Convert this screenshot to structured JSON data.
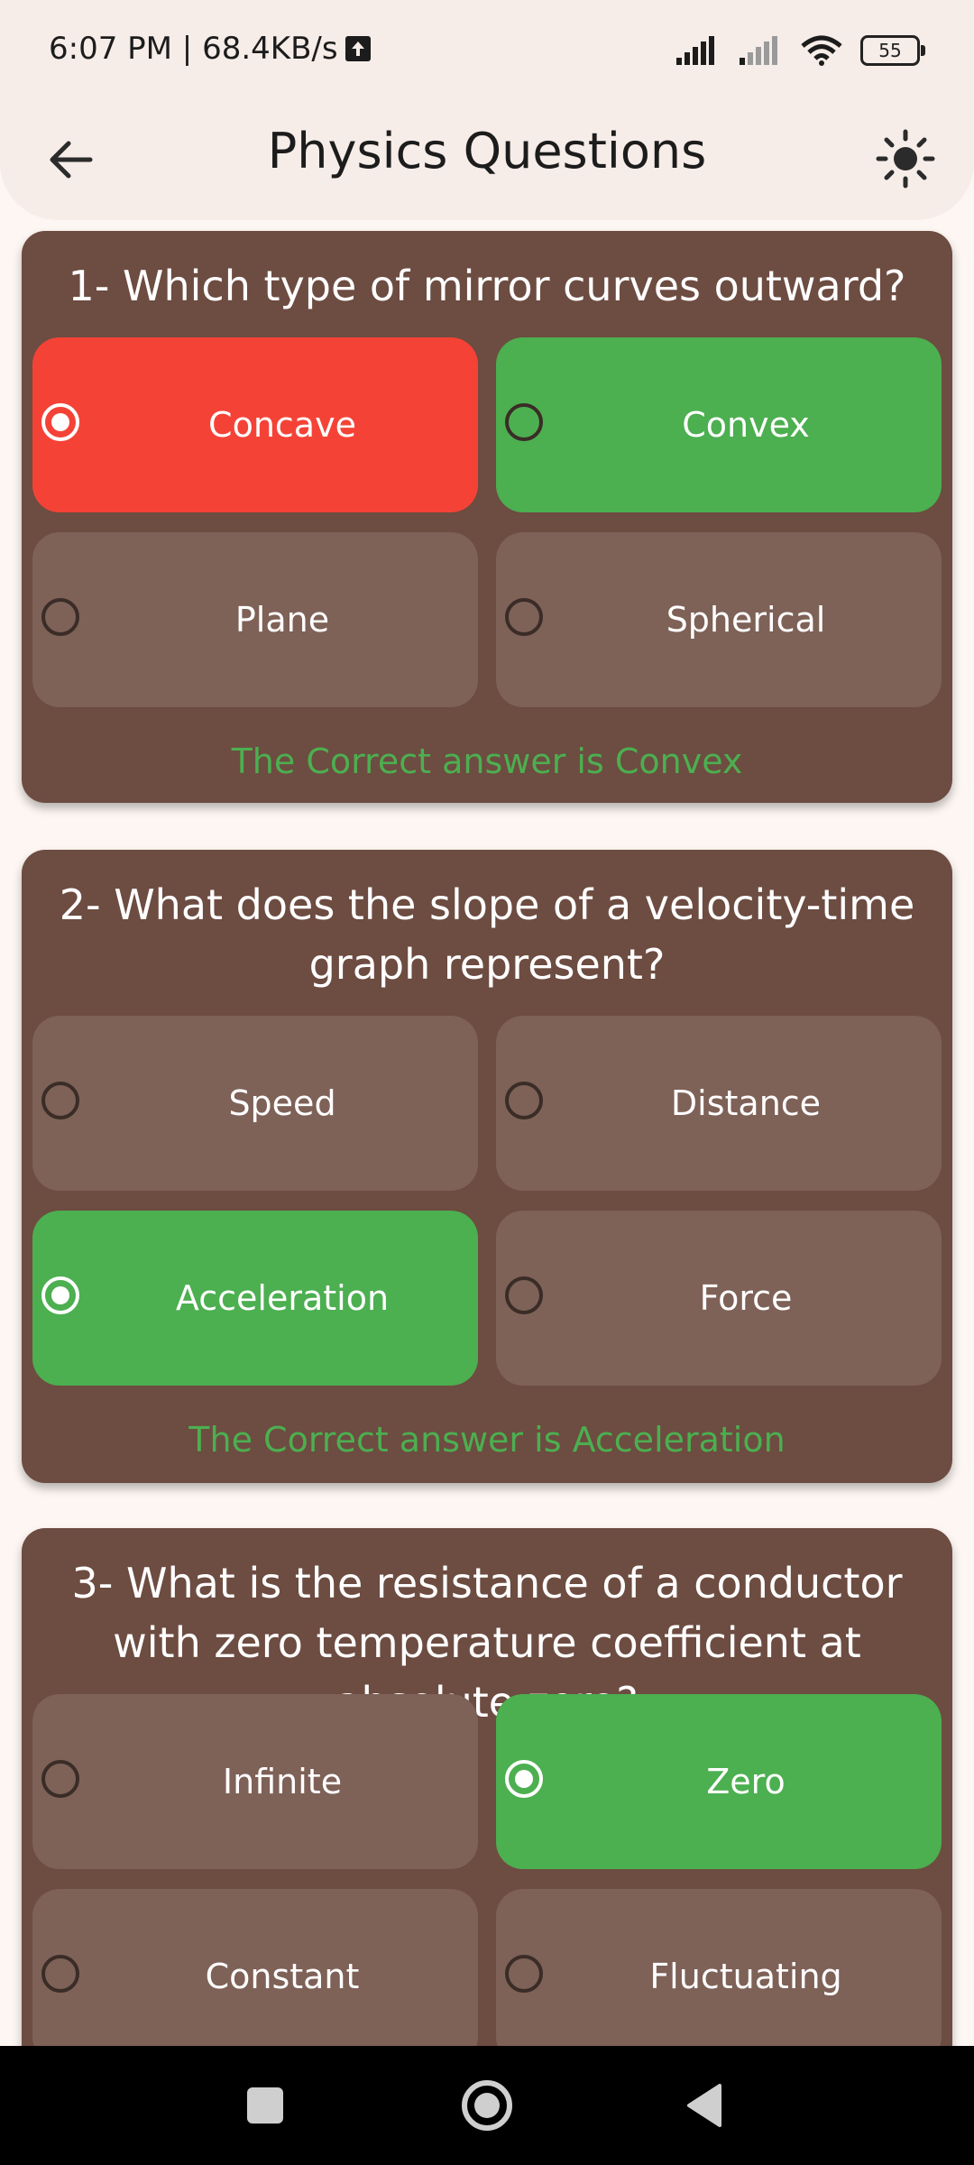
{
  "status_bar": {
    "time": "6:07 PM | 68.4KB/s",
    "battery": "55",
    "icons": [
      "upload-icon",
      "signal-icon",
      "signal-icon",
      "wifi-icon",
      "battery-icon"
    ]
  },
  "app_bar": {
    "title": "Physics Questions",
    "back_icon": "arrow-left-icon",
    "theme_icon": "sun-icon"
  },
  "colors": {
    "card": "#6d4c41",
    "option": "#7e6157",
    "wrong": "#f44336",
    "correct": "#4caf50",
    "answer_text": "#4caf50"
  },
  "questions": [
    {
      "question": "1- Which type of mirror curves outward?",
      "options": [
        {
          "label": "Concave",
          "state": "wrong",
          "selected": true
        },
        {
          "label": "Convex",
          "state": "correct",
          "selected": false
        },
        {
          "label": "Plane",
          "state": "neutral",
          "selected": false
        },
        {
          "label": "Spherical",
          "state": "neutral",
          "selected": false
        }
      ],
      "answer": "The Correct answer is Convex"
    },
    {
      "question": "2- What does the slope of a velocity-time graph represent?",
      "options": [
        {
          "label": "Speed",
          "state": "neutral",
          "selected": false
        },
        {
          "label": "Distance",
          "state": "neutral",
          "selected": false
        },
        {
          "label": "Acceleration",
          "state": "correct",
          "selected": true
        },
        {
          "label": "Force",
          "state": "neutral",
          "selected": false
        }
      ],
      "answer": "The Correct answer is Acceleration"
    },
    {
      "question": "3- What is the resistance of a conductor with zero temperature coefficient at absolute zero?",
      "options": [
        {
          "label": "Infinite",
          "state": "neutral",
          "selected": false
        },
        {
          "label": "Zero",
          "state": "correct",
          "selected": true
        },
        {
          "label": "Constant",
          "state": "neutral",
          "selected": false
        },
        {
          "label": "Fluctuating",
          "state": "neutral",
          "selected": false
        }
      ],
      "answer": ""
    }
  ],
  "nav_bar": {
    "icons": [
      "recents-square-icon",
      "home-circle-icon",
      "back-triangle-icon"
    ]
  }
}
